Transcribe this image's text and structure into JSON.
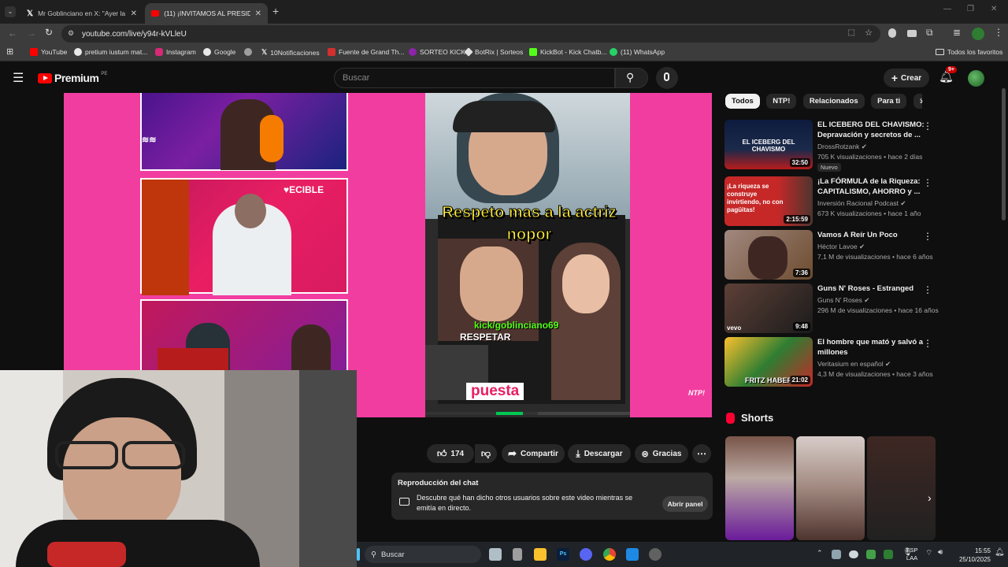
{
  "tabs": [
    {
      "title": "Mr Goblinciano en X: \"Ayer la s",
      "icon": "x-logo-icon"
    },
    {
      "title": "(11) ¡INVITAMOS AL PRESIDEN",
      "icon": "youtube-icon"
    }
  ],
  "address": {
    "url": "youtube.com/live/y94r-kVLleU"
  },
  "bookmarks": [
    {
      "label": "YouTube",
      "color": "#ff0000"
    },
    {
      "label": "pretium iustum mat...",
      "color": "#e8e8e8"
    },
    {
      "label": "Instagram",
      "color": "#d62976"
    },
    {
      "label": "Google",
      "color": "#e8e8e8"
    },
    {
      "label": "",
      "color": "#9e9e9e"
    },
    {
      "label": "10Notificaciones",
      "color": "#e8e8e8"
    },
    {
      "label": "Fuente de Grand Th...",
      "color": "#d32f2f"
    },
    {
      "label": "SORTEO KICK",
      "color": "#8e24aa"
    },
    {
      "label": "BotRix | Sorteos",
      "color": "#e0e0e0"
    },
    {
      "label": "KickBot - Kick Chatb...",
      "color": "#53fc18"
    },
    {
      "label": "(11) WhatsApp",
      "color": "#25d366"
    }
  ],
  "all_bookmarks": "Todos los favoritos",
  "yt": {
    "logo": "Premium",
    "region": "PE",
    "search_placeholder": "Buscar",
    "create": "Crear",
    "notif_count": "9+"
  },
  "video": {
    "caption": "Respeto mas a la actriz nopor",
    "kick": "kick/goblinciano69",
    "respetar": "RESPETAR",
    "puesta": "puesta",
    "watermark": "NTP!"
  },
  "actions": {
    "likes": "174",
    "share": "Compartir",
    "download": "Descargar",
    "thanks": "Gracias"
  },
  "chat": {
    "title": "Reproducción del chat",
    "description": "Descubre qué han dicho otros usuarios sobre este video mientras se emitía en directo.",
    "open": "Abrir panel"
  },
  "filters": [
    "Todos",
    "NTP!",
    "Relacionados",
    "Para ti",
    "Su"
  ],
  "recommendations": [
    {
      "title": "EL ICEBERG DEL CHAVISMO: Depravación y secretos de ...",
      "channel": "DrossRotzank",
      "meta": "705 K visualizaciones • hace 2 días",
      "badge": "Nuevo",
      "duration": "32:50",
      "thumb_text": "EL ICEBERG DEL CHAVISMO",
      "color": "#1b2a4a"
    },
    {
      "title": "¡La FÓRMULA de la Riqueza: CAPITALISMO, AHORRO y ...",
      "channel": "Inversión Racional Podcast",
      "meta": "673 K visualizaciones • hace 1 año",
      "badge": "",
      "duration": "2:15:59",
      "thumb_text": "¡La riqueza se construye invirtiendo, no con pagüitas!",
      "color": "#c62828"
    },
    {
      "title": "Vamos A Reír Un Poco",
      "channel": "Héctor Lavoe",
      "meta": "7,1 M de visualizaciones • hace 6 años",
      "badge": "",
      "duration": "7:36",
      "thumb_text": "",
      "color": "#6d4c2f"
    },
    {
      "title": "Guns N' Roses - Estranged",
      "channel": "Guns N' Roses",
      "meta": "296 M de visualizaciones • hace 16 años",
      "badge": "",
      "duration": "9:48",
      "thumb_text": "vevo",
      "color": "#3b2a22"
    },
    {
      "title": "El hombre que mató y salvó a millones",
      "channel": "Veritasium en español",
      "meta": "4,3 M de visualizaciones • hace 3 años",
      "badge": "",
      "duration": "21:02",
      "thumb_text": "FRITZ HABER",
      "color": "#2e7d32"
    }
  ],
  "shorts_label": "Shorts",
  "taskbar": {
    "search": "Buscar",
    "lang": "ESP",
    "lang2": "LAA",
    "time": "15:55",
    "date": "25/10/2025"
  }
}
